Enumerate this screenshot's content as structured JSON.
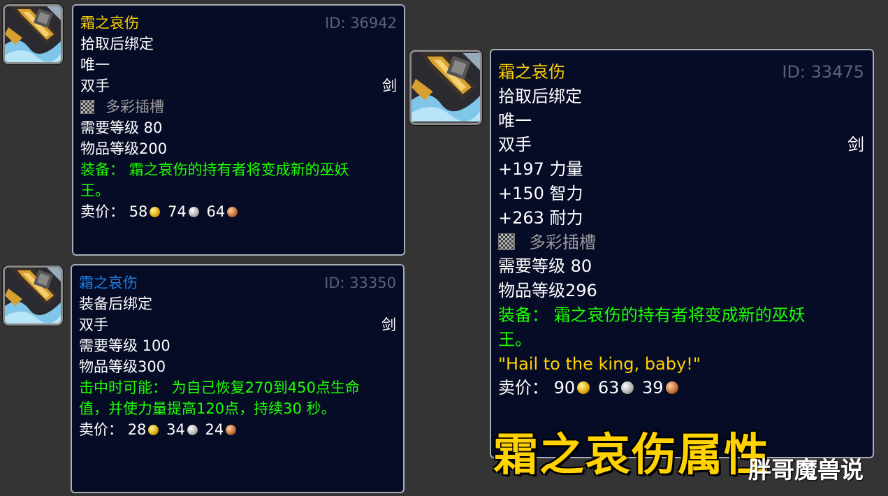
{
  "tooltips": [
    {
      "name": "霜之哀伤",
      "id": "ID: 36942",
      "bind": "拾取后绑定",
      "unique": "唯一",
      "hand": "双手",
      "weapon_type": "剑",
      "socket": "多彩插槽",
      "req_level": "需要等级 80",
      "item_level": "物品等级200",
      "equip_line1": "装备： 霜之哀伤的持有者将变成新的巫妖",
      "equip_line2": "王。",
      "sell_label": "卖价：",
      "gold": "58",
      "silver": "74",
      "copper": "64"
    },
    {
      "name": "霜之哀伤",
      "id": "ID: 33350",
      "bind": "装备后绑定",
      "hand": "双手",
      "weapon_type": "剑",
      "req_level": "需要等级 100",
      "item_level": "物品等级300",
      "proc_line1": "击中时可能： 为自己恢复270到450点生命",
      "proc_line2": "值，并使力量提高120点，持续30 秒。",
      "sell_label": "卖价：",
      "gold": "28",
      "silver": "34",
      "copper": "24"
    },
    {
      "name": "霜之哀伤",
      "id": "ID: 33475",
      "bind": "拾取后绑定",
      "unique": "唯一",
      "hand": "双手",
      "weapon_type": "剑",
      "stat_strength": "+197 力量",
      "stat_intellect": "+150 智力",
      "stat_stamina": "+263 耐力",
      "socket": "多彩插槽",
      "req_level": "需要等级 80",
      "item_level": "物品等级296",
      "equip_line1": "装备： 霜之哀伤的持有者将变成新的巫妖",
      "equip_line2": "王。",
      "flavor": "\"Hail to the king, baby!\"",
      "sell_label": "卖价：",
      "gold": "90",
      "silver": "63",
      "copper": "39"
    }
  ],
  "caption": "霜之哀伤属性",
  "watermark": "胖哥魔兽说",
  "colors": {
    "item_name_epic": "#ffd100",
    "item_name_blue": "#1f7fe0",
    "green_text": "#1eff00",
    "tooltip_bg": "#060b26",
    "caption": "#ffd200"
  },
  "icons": [
    "frostmourne-icon",
    "socket-prismatic-icon",
    "gold-coin-icon",
    "silver-coin-icon",
    "copper-coin-icon"
  ]
}
